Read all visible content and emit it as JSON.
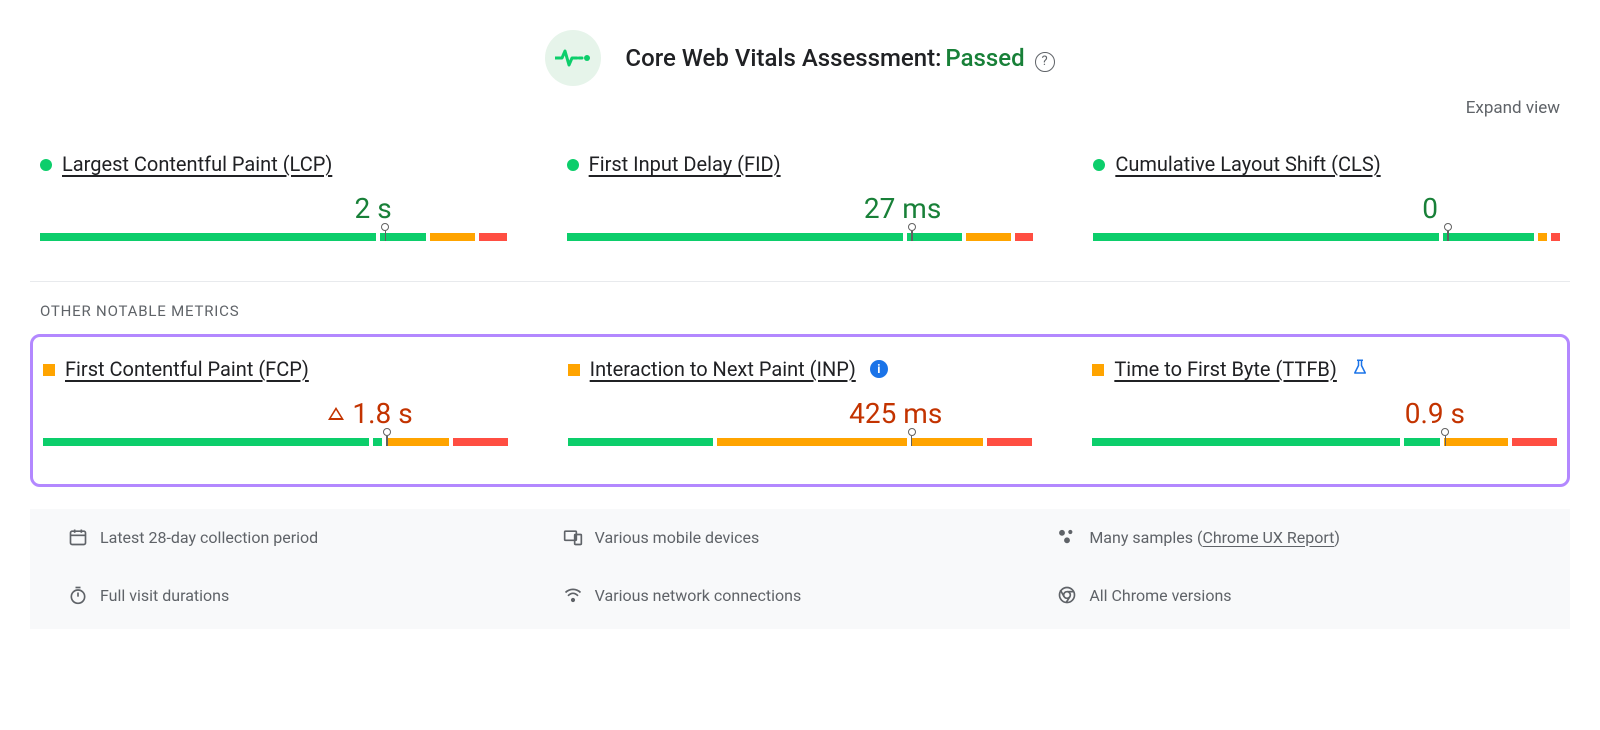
{
  "header": {
    "title_prefix": "Core Web Vitals Assessment:",
    "status": "Passed",
    "expand_label": "Expand view"
  },
  "core_metrics": [
    {
      "name": "Largest Contentful Paint (LCP)",
      "value": "2 s",
      "status": "green",
      "marker_pct": 74,
      "segments": [
        74,
        10,
        10,
        6
      ],
      "warn": false,
      "info": false,
      "flask": false,
      "value_pad": 115
    },
    {
      "name": "First Input Delay (FID)",
      "value": "27 ms",
      "status": "green",
      "marker_pct": 74,
      "segments": [
        74,
        12,
        10,
        4
      ],
      "warn": false,
      "info": false,
      "flask": false,
      "value_pad": 92
    },
    {
      "name": "Cumulative Layout Shift (CLS)",
      "value": "0",
      "status": "green",
      "marker_pct": 76,
      "segments": [
        76,
        20,
        2,
        2
      ],
      "warn": false,
      "info": false,
      "flask": false,
      "value_pad": 122
    }
  ],
  "section_label": "OTHER NOTABLE METRICS",
  "other_metrics": [
    {
      "name": "First Contentful Paint (FCP)",
      "value": "1.8 s",
      "status": "orange",
      "marker_pct": 74,
      "segments": [
        72,
        2,
        14,
        12
      ],
      "warn": true,
      "info": false,
      "flask": false,
      "value_pad": 95
    },
    {
      "name": "Interaction to Next Paint (INP)",
      "value": "425 ms",
      "status": "orange",
      "marker_pct": 74,
      "segments": [
        32,
        42,
        16,
        10
      ],
      "warn": false,
      "info": true,
      "flask": false,
      "value_pad": 90
    },
    {
      "name": "Time to First Byte (TTFB)",
      "value": "0.9 s",
      "status": "orange",
      "marker_pct": 76,
      "segments": [
        68,
        8,
        14,
        10
      ],
      "warn": false,
      "info": false,
      "flask": true,
      "value_pad": 92
    }
  ],
  "info_panel": {
    "period": "Latest 28-day collection period",
    "devices": "Various mobile devices",
    "samples_prefix": "Many samples (",
    "samples_link": "Chrome UX Report",
    "samples_suffix": ")",
    "durations": "Full visit durations",
    "connections": "Various network connections",
    "versions": "All Chrome versions"
  },
  "colors": {
    "green": "#0cce6b",
    "orange": "#ffa400",
    "red": "#ff4e42"
  },
  "chart_data": [
    {
      "type": "bar",
      "title": "Largest Contentful Paint (LCP)",
      "categories": [
        "good",
        "needs-improvement-a",
        "needs-improvement-b",
        "poor"
      ],
      "values": [
        74,
        10,
        10,
        6
      ],
      "marker": 74,
      "value_label": "2 s"
    },
    {
      "type": "bar",
      "title": "First Input Delay (FID)",
      "categories": [
        "good",
        "needs-improvement-a",
        "needs-improvement-b",
        "poor"
      ],
      "values": [
        74,
        12,
        10,
        4
      ],
      "marker": 74,
      "value_label": "27 ms"
    },
    {
      "type": "bar",
      "title": "Cumulative Layout Shift (CLS)",
      "categories": [
        "good",
        "needs-improvement-a",
        "needs-improvement-b",
        "poor"
      ],
      "values": [
        76,
        20,
        2,
        2
      ],
      "marker": 76,
      "value_label": "0"
    },
    {
      "type": "bar",
      "title": "First Contentful Paint (FCP)",
      "categories": [
        "good-a",
        "good-b",
        "needs-improvement",
        "poor"
      ],
      "values": [
        72,
        2,
        14,
        12
      ],
      "marker": 74,
      "value_label": "1.8 s"
    },
    {
      "type": "bar",
      "title": "Interaction to Next Paint (INP)",
      "categories": [
        "good",
        "needs-improvement-a",
        "needs-improvement-b",
        "poor"
      ],
      "values": [
        32,
        42,
        16,
        10
      ],
      "marker": 74,
      "value_label": "425 ms"
    },
    {
      "type": "bar",
      "title": "Time to First Byte (TTFB)",
      "categories": [
        "good-a",
        "good-b",
        "needs-improvement",
        "poor"
      ],
      "values": [
        68,
        8,
        14,
        10
      ],
      "marker": 76,
      "value_label": "0.9 s"
    }
  ]
}
